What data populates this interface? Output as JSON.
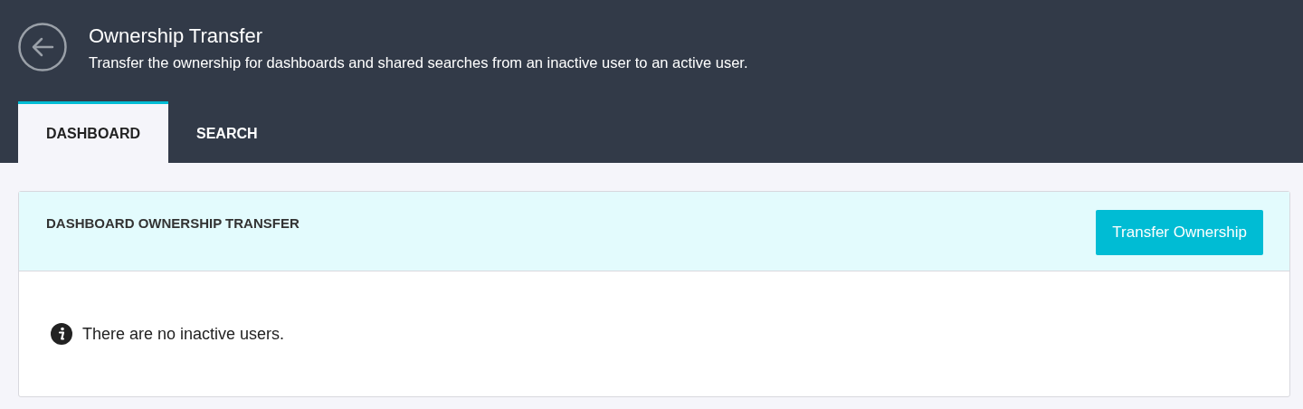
{
  "header": {
    "title": "Ownership Transfer",
    "subtitle": "Transfer the ownership for dashboards and shared searches from an inactive user to an active user."
  },
  "tabs": [
    {
      "label": "DASHBOARD",
      "selected": true
    },
    {
      "label": "SEARCH",
      "selected": false
    }
  ],
  "card": {
    "title": "DASHBOARD OWNERSHIP TRANSFER",
    "button": "Transfer Ownership",
    "message": "There are no inactive users."
  }
}
